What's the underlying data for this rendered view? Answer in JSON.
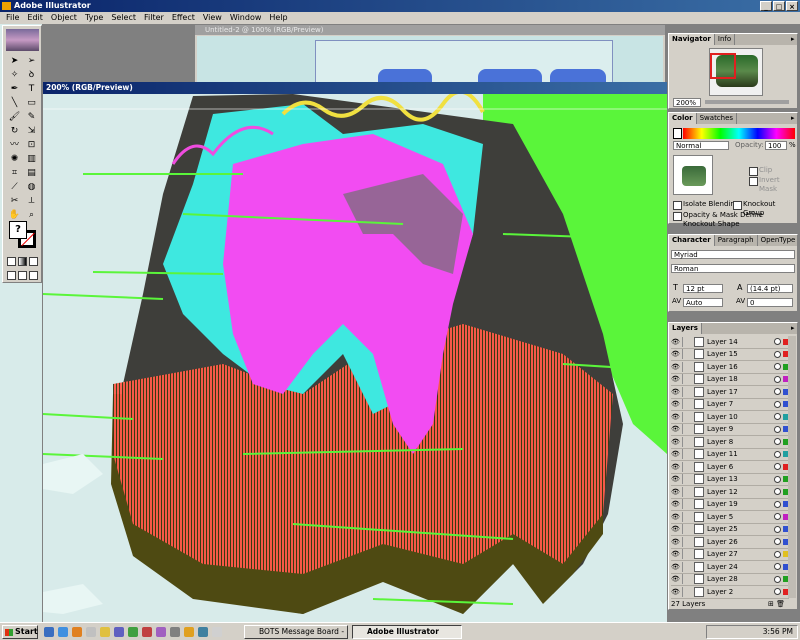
{
  "app": {
    "title": "Adobe Illustrator"
  },
  "menu": [
    "File",
    "Edit",
    "Object",
    "Type",
    "Select",
    "Filter",
    "Effect",
    "View",
    "Window",
    "Help"
  ],
  "docs": {
    "back_title": "Untitled-2 @ 100% (RGB/Preview)",
    "front_title": "200% (RGB/Preview)"
  },
  "navigator": {
    "tabs": [
      "Navigator",
      "Info"
    ],
    "zoom": "200%"
  },
  "color_palette": {
    "tabs": [
      "Color",
      "Swatches"
    ],
    "blend_mode": "Normal",
    "opacity_label": "Opacity:",
    "opacity_value": "100",
    "opacity_unit": "%",
    "clip_label": "Clip",
    "invert_mask_label": "Invert Mask",
    "isolate_blending_label": "Isolate Blending",
    "knockout_group_label": "Knockout Group",
    "opacity_mask_label": "Opacity & Mask Define Knockout Shape"
  },
  "character": {
    "tabs": [
      "Character",
      "Paragraph",
      "OpenType"
    ],
    "font_family": "Myriad",
    "font_style": "Roman",
    "size": "12 pt",
    "leading": "(14.4 pt)",
    "tracking": "Auto",
    "kerning": "0"
  },
  "layers": {
    "tab": "Layers",
    "count_text": "27 Layers",
    "items": [
      {
        "name": "Layer 14",
        "color": "#e02020"
      },
      {
        "name": "Layer 15",
        "color": "#e02020"
      },
      {
        "name": "Layer 16",
        "color": "#20a020"
      },
      {
        "name": "Layer 18",
        "color": "#c020c0"
      },
      {
        "name": "Layer 17",
        "color": "#3050d0"
      },
      {
        "name": "Layer 7",
        "color": "#3050d0"
      },
      {
        "name": "Layer 10",
        "color": "#20a0a0"
      },
      {
        "name": "Layer 9",
        "color": "#3050d0"
      },
      {
        "name": "Layer 8",
        "color": "#20a020"
      },
      {
        "name": "Layer 11",
        "color": "#20a0a0"
      },
      {
        "name": "Layer 6",
        "color": "#e02020"
      },
      {
        "name": "Layer 13",
        "color": "#20a020"
      },
      {
        "name": "Layer 12",
        "color": "#20a020"
      },
      {
        "name": "Layer 19",
        "color": "#3050d0"
      },
      {
        "name": "Layer 5",
        "color": "#c020c0"
      },
      {
        "name": "Layer 25",
        "color": "#3050d0"
      },
      {
        "name": "Layer 26",
        "color": "#3050d0"
      },
      {
        "name": "Layer 27",
        "color": "#e0c020"
      },
      {
        "name": "Layer 24",
        "color": "#3050d0"
      },
      {
        "name": "Layer 28",
        "color": "#20a020"
      },
      {
        "name": "Layer 2",
        "color": "#e02020"
      }
    ]
  },
  "taskbar": {
    "start": "Start",
    "tasks": [
      "BOTS Message Board - M...",
      "Adobe Illustrator"
    ],
    "clock": "3:56 PM"
  }
}
